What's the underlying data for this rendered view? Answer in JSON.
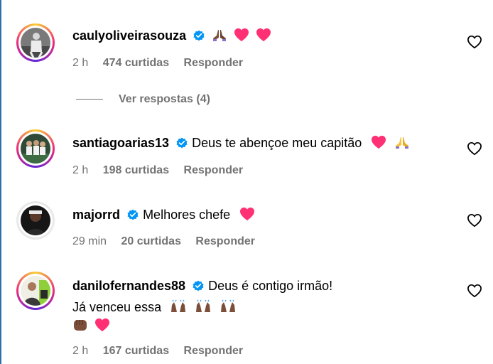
{
  "comments": [
    {
      "username": "caulyoliveirasouza",
      "text": "",
      "emojis": [
        "pray",
        "heart",
        "heart"
      ],
      "time": "2 h",
      "likes": "474 curtidas",
      "reply_label": "Responder",
      "view_replies": "Ver respostas (4)"
    },
    {
      "username": "santiagoarias13",
      "text": "Deus te abençoe meu capitão",
      "emojis": [
        "heart",
        "pray"
      ],
      "time": "2 h",
      "likes": "198 curtidas",
      "reply_label": "Responder"
    },
    {
      "username": "majorrd",
      "text": "Melhores chefe",
      "emojis": [
        "heart"
      ],
      "time": "29 min",
      "likes": "20 curtidas",
      "reply_label": "Responder"
    },
    {
      "username": "danilofernandes88",
      "text": "Deus é contigo irmão!",
      "line2": "Já venceu essa",
      "emojis_line2": [
        "raising-hands",
        "raising-hands",
        "raising-hands"
      ],
      "emojis_line3": [
        "fist",
        "heart"
      ],
      "time": "2 h",
      "likes": "167 curtidas",
      "reply_label": "Responder"
    }
  ],
  "colors": {
    "verified": "#0095f6",
    "heart": "#ff3040",
    "meta": "#737373"
  }
}
